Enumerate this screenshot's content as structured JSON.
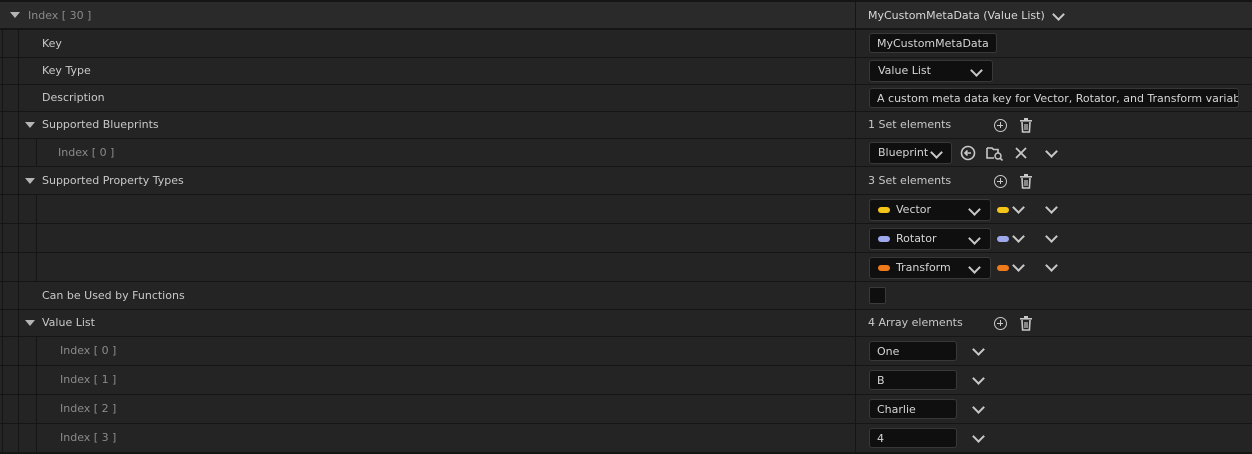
{
  "header": {
    "label": "Index [ 30 ]",
    "value": "MyCustomMetaData (Value List)"
  },
  "key": {
    "label": "Key",
    "value": "MyCustomMetaData"
  },
  "key_type": {
    "label": "Key Type",
    "value": "Value List"
  },
  "description": {
    "label": "Description",
    "value": "A custom meta data key for Vector, Rotator, and Transform variables"
  },
  "supported_blueprints": {
    "label": "Supported Blueprints",
    "count": "1 Set elements",
    "items": [
      {
        "label": "Index [ 0 ]",
        "value": "Blueprint"
      }
    ]
  },
  "supported_property_types": {
    "label": "Supported Property Types",
    "count": "3 Set elements",
    "items": [
      {
        "value": "Vector",
        "color": "#f5c518"
      },
      {
        "value": "Rotator",
        "color": "#9fa8ec"
      },
      {
        "value": "Transform",
        "color": "#f07a1a"
      }
    ]
  },
  "can_be_used_by_functions": {
    "label": "Can be Used by Functions",
    "checked": false
  },
  "value_list": {
    "label": "Value List",
    "count": "4 Array elements",
    "items": [
      {
        "label": "Index [ 0 ]",
        "value": "One"
      },
      {
        "label": "Index [ 1 ]",
        "value": "B"
      },
      {
        "label": "Index [ 2 ]",
        "value": "Charlie"
      },
      {
        "label": "Index [ 3 ]",
        "value": "4"
      }
    ]
  }
}
